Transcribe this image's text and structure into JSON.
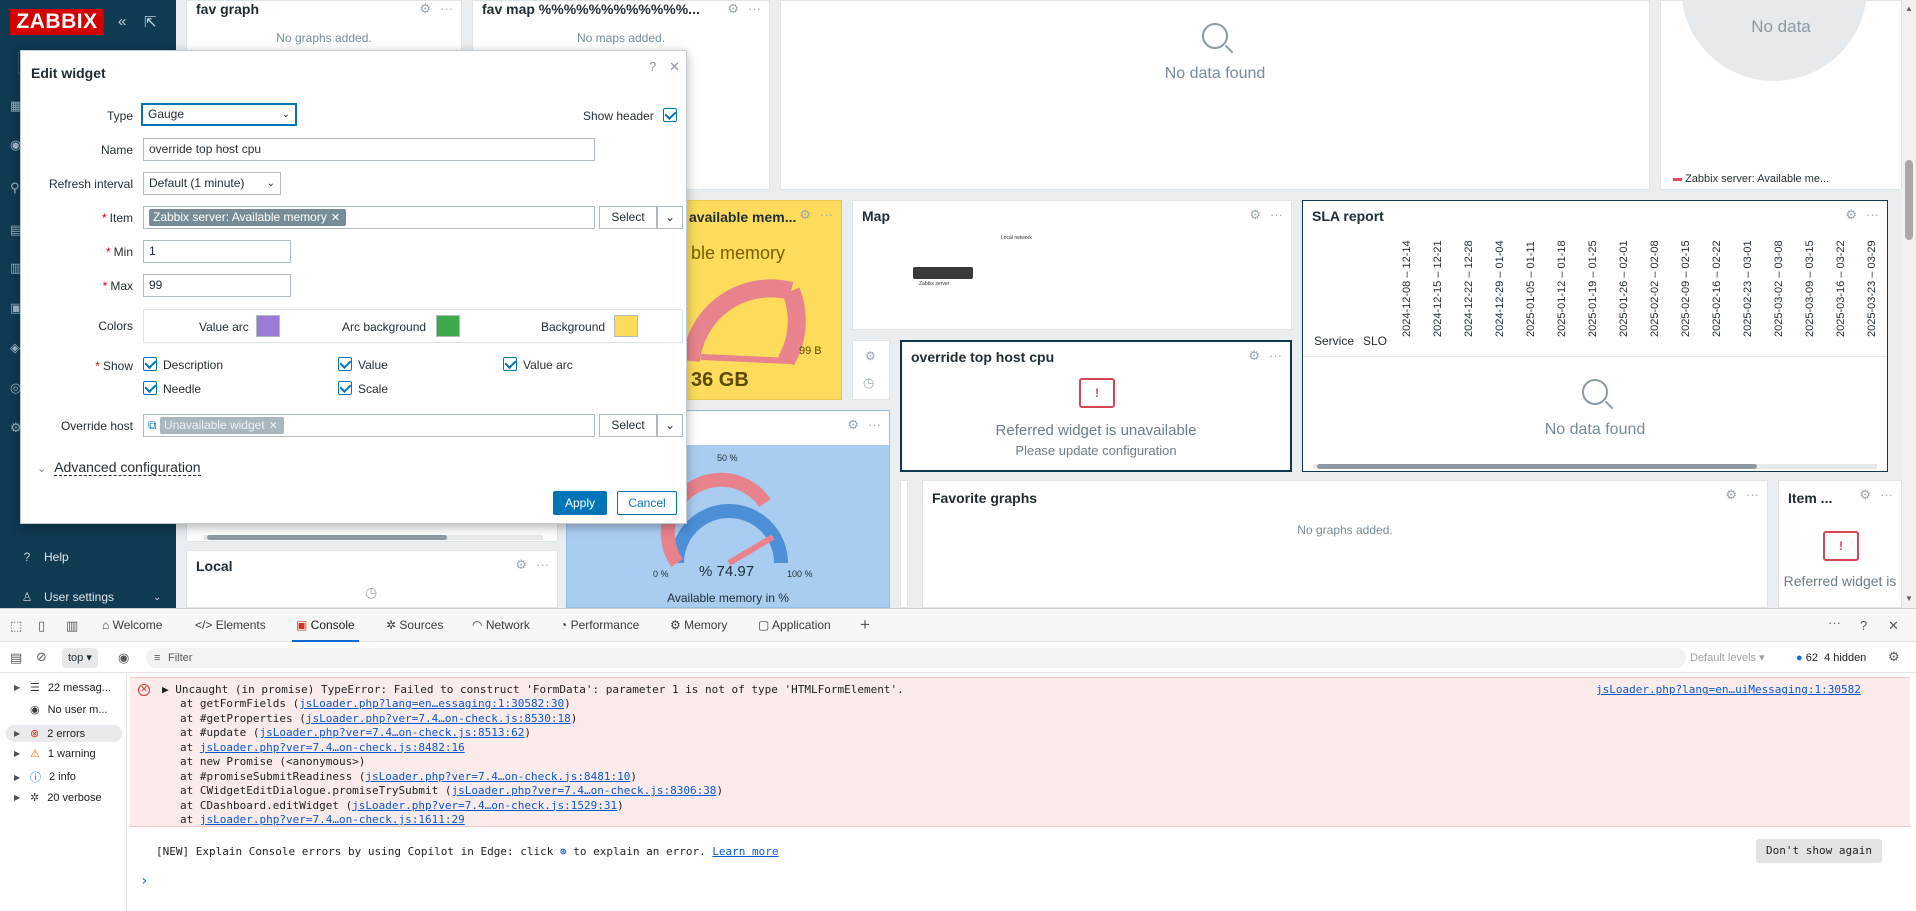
{
  "sidebar": {
    "logo": "ZABBIX",
    "collapse_glyph": "«",
    "kiosk_glyph": "⇱",
    "help_label": "Help",
    "user_settings_label": "User settings"
  },
  "widgets": {
    "fav_graph": {
      "title": "fav graph",
      "message": "No graphs added."
    },
    "fav_map": {
      "title": "fav map %%%%%%%%%%%%...",
      "message": "No maps added."
    },
    "no_data_top": {
      "message": "No data found"
    },
    "pie_top": {
      "message": "No data",
      "legend": "Zabbix server: Available me..."
    },
    "available_mem": {
      "title": "available mem...",
      "text": "ble memory",
      "value": "36 GB",
      "max_label": "99 B"
    },
    "map": {
      "title": "Map",
      "map_caption": "Local network",
      "host_caption": "Zabbix server"
    },
    "sla": {
      "title": "SLA report",
      "col_service": "Service",
      "col_slo": "SLO",
      "dates": [
        "2024-12-08 – 12-14",
        "2024-12-15 – 12-21",
        "2024-12-22 – 12-28",
        "2024-12-29 – 01-04",
        "2025-01-05 – 01-11",
        "2025-01-12 – 01-18",
        "2025-01-19 – 01-25",
        "2025-01-26 – 02-01",
        "2025-02-02 – 02-08",
        "2025-02-09 – 02-15",
        "2025-02-16 – 02-22",
        "2025-02-23 – 03-01",
        "2025-03-02 – 03-08",
        "2025-03-09 – 03-15",
        "2025-03-16 – 03-22",
        "2025-03-23 – 03-29"
      ],
      "message": "No data found"
    },
    "override": {
      "title": "override top host cpu",
      "msg1": "Referred widget is unavailable",
      "msg2": "Please update configuration"
    },
    "favorite_graphs": {
      "title": "Favorite graphs",
      "message": "No graphs added."
    },
    "item": {
      "title": "Item ...",
      "msg": "Referred widget is"
    },
    "local": {
      "title": "Local"
    },
    "gauge_pct": {
      "top_label": "50 %",
      "min_label": "0 %",
      "max_label": "100 %",
      "value": "% 74.97",
      "caption": "Available memory in %"
    }
  },
  "dialog": {
    "title": "Edit widget",
    "help_glyph": "?",
    "close_glyph": "✕",
    "type_label": "Type",
    "type_value": "Gauge",
    "show_header_label": "Show header",
    "name_label": "Name",
    "name_value": "override top host cpu",
    "refresh_label": "Refresh interval",
    "refresh_value": "Default (1 minute)",
    "item_label": "Item",
    "item_value": "Zabbix server: Available memory",
    "select_label": "Select",
    "min_label": "Min",
    "min_value": "1",
    "max_label": "Max",
    "max_value": "99",
    "colors_label": "Colors",
    "value_arc_label": "Value arc",
    "value_arc_color": "#9c7ad6",
    "arc_bg_label": "Arc background",
    "arc_bg_color": "#3daa4b",
    "background_label": "Background",
    "background_color": "#fcdc5a",
    "show_label": "Show",
    "show_options": [
      "Description",
      "Value",
      "Value arc",
      "Needle",
      "Scale"
    ],
    "override_host_label": "Override host",
    "override_host_value": "Unavailable widget",
    "advanced_label": "Advanced configuration",
    "apply_label": "Apply",
    "cancel_label": "Cancel"
  },
  "devtools": {
    "tabs": [
      "Welcome",
      "Elements",
      "Console",
      "Sources",
      "Network",
      "Performance",
      "Memory",
      "Application"
    ],
    "context": "top",
    "filter_placeholder": "Filter",
    "default_levels": "Default levels",
    "issues_count": "62",
    "hidden_count": "4 hidden",
    "sidebar_items": [
      {
        "label": "22 messag...",
        "icon": "☰"
      },
      {
        "label": "No user m...",
        "icon": "◉"
      },
      {
        "label": "2 errors",
        "icon": "⊗"
      },
      {
        "label": "1 warning",
        "icon": "⚠"
      },
      {
        "label": "2 info",
        "icon": "ⓘ"
      },
      {
        "label": "20 verbose",
        "icon": "✲"
      }
    ],
    "error_main": "Uncaught (in promise) TypeError: Failed to construct 'FormData': parameter 1 is not of type 'HTMLFormElement'.",
    "error_source": "jsLoader.php?lang=en…uiMessaging:1:30582",
    "stack": [
      {
        "fn": "at getFormFields (",
        "link": "jsLoader.php?lang=en…essaging:1:30582:30",
        "end": ")"
      },
      {
        "fn": "at #getProperties (",
        "link": "jsLoader.php?ver=7.4…on-check.js:8530:18",
        "end": ")"
      },
      {
        "fn": "at #update (",
        "link": "jsLoader.php?ver=7.4…on-check.js:8513:62",
        "end": ")"
      },
      {
        "fn": "at ",
        "link": "jsLoader.php?ver=7.4…on-check.js:8482:16",
        "end": ""
      },
      {
        "fn": "at new Promise (<anonymous>)",
        "link": "",
        "end": ""
      },
      {
        "fn": "at #promiseSubmitReadiness (",
        "link": "jsLoader.php?ver=7.4…on-check.js:8481:10",
        "end": ")"
      },
      {
        "fn": "at CWidgetEditDialogue.promiseTrySubmit (",
        "link": "jsLoader.php?ver=7.4…on-check.js:8306:38",
        "end": ")"
      },
      {
        "fn": "at CDashboard.editWidget (",
        "link": "jsLoader.php?ver=7.4…on-check.js:1529:31",
        "end": ")"
      },
      {
        "fn": "at ",
        "link": "jsLoader.php?ver=7.4…on-check.js:1611:29",
        "end": ""
      }
    ],
    "copilot_text": "[NEW] Explain Console errors by using Copilot in Edge: click",
    "copilot_text2": "to explain an error.",
    "learn_more": "Learn more",
    "dont_show": "Don't show again",
    "prompt": "›"
  }
}
